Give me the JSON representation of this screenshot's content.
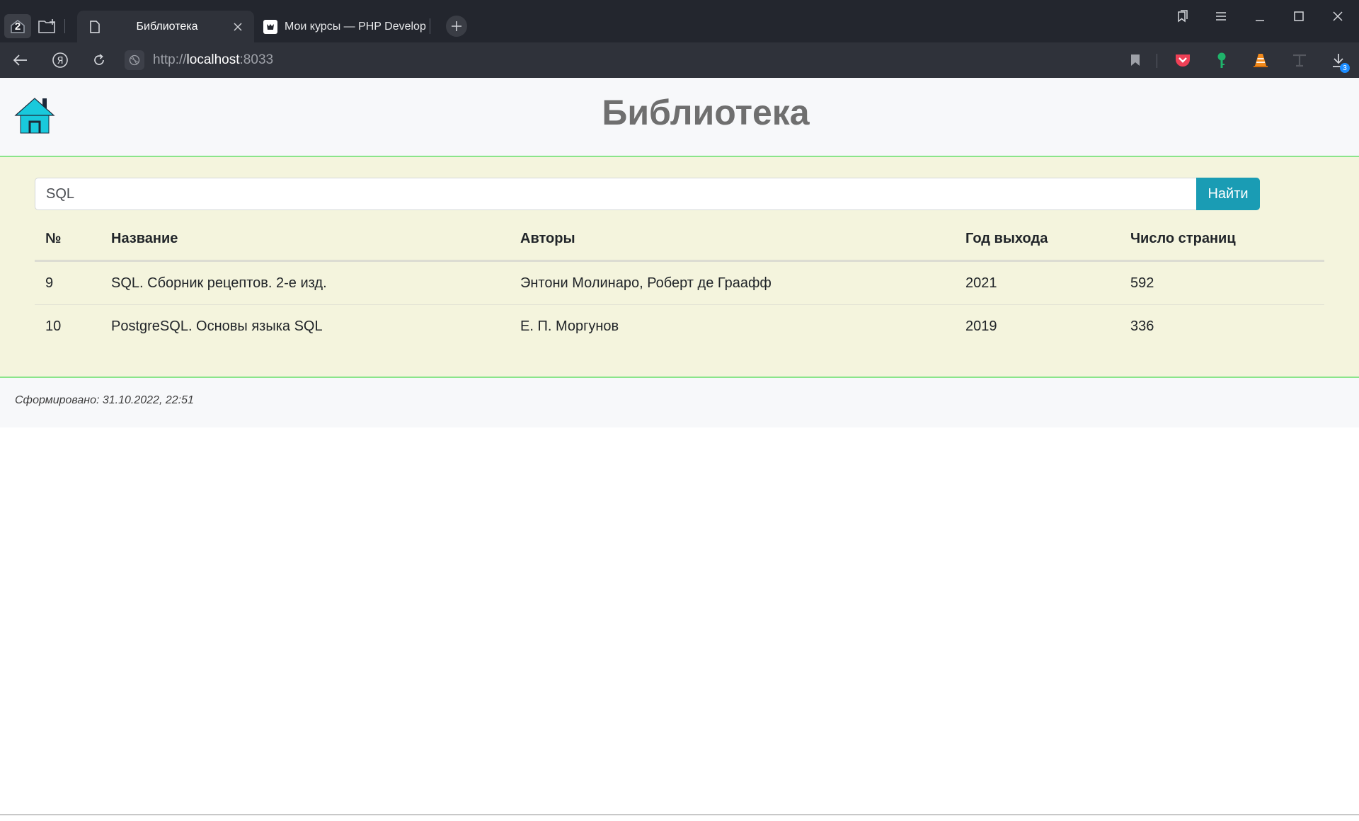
{
  "browser": {
    "tab_count": "2",
    "tabs": [
      {
        "label": "Библиотека",
        "active": true
      },
      {
        "label": "Мои курсы — PHP Develop",
        "active": false
      }
    ],
    "url_prefix": "http://",
    "url_host": "localhost",
    "url_port": ":8033",
    "downloads_badge": "3"
  },
  "site": {
    "title": "Библиотека",
    "home_icon": "home-icon"
  },
  "search": {
    "value": "SQL",
    "button_label": "Найти"
  },
  "table": {
    "headers": [
      "№",
      "Название",
      "Авторы",
      "Год выхода",
      "Число страниц"
    ],
    "rows": [
      [
        "9",
        "SQL. Сборник рецептов. 2-е изд.",
        "Энтони Молинаро, Роберт де Граафф",
        "2021",
        "592"
      ],
      [
        "10",
        "PostgreSQL. Основы языка SQL",
        "Е. П. Моргунов",
        "2019",
        "336"
      ]
    ]
  },
  "footer": {
    "generated": "Сформировано: 31.10.2022, 22:51"
  },
  "colors": {
    "accent_button": "#1a9cb4",
    "main_background": "#f4f4dd",
    "divider_green": "#8ae58a",
    "home_icon": "#19c9dc"
  }
}
